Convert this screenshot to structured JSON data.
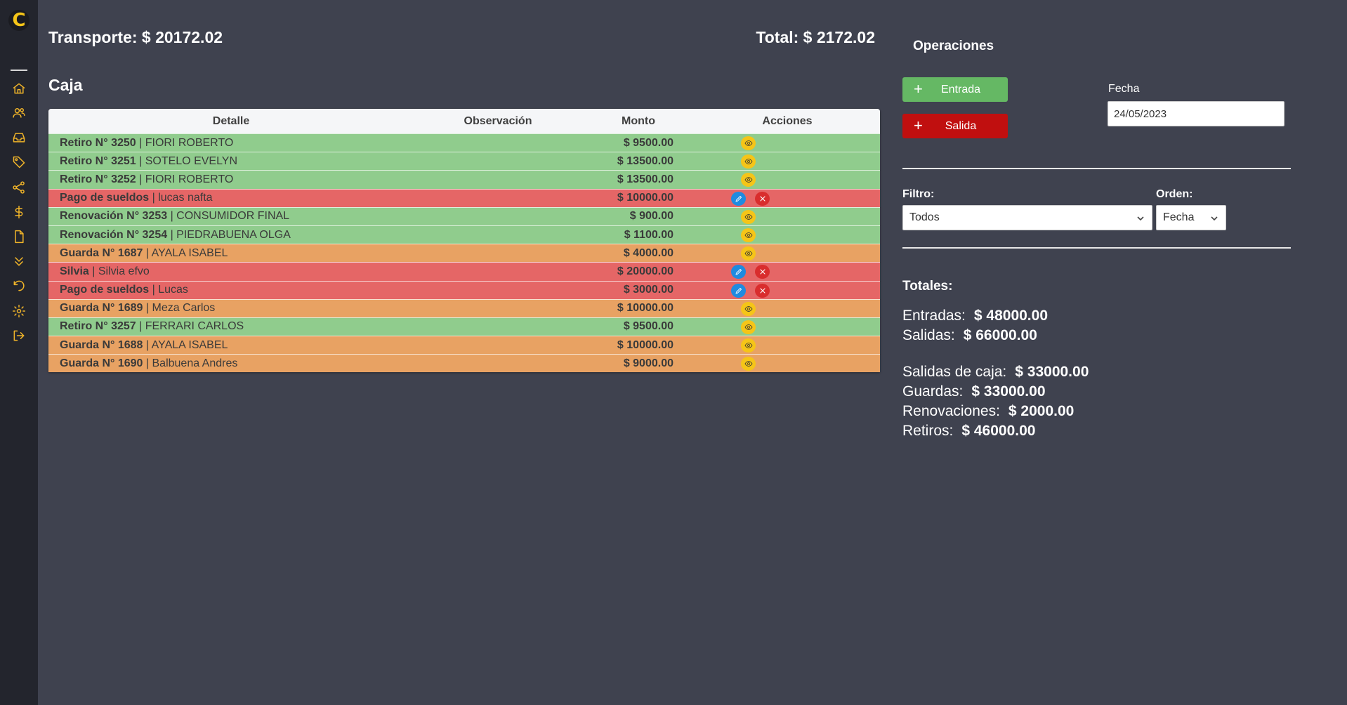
{
  "sidebar": {
    "logo": "C",
    "icons": [
      "home-icon",
      "users-icon",
      "inbox-icon",
      "tag-icon",
      "share-icon",
      "dollar-icon",
      "file-icon",
      "chevrons-down-icon",
      "undo-icon",
      "settings-icon",
      "logout-icon"
    ]
  },
  "header": {
    "transporte": "Transporte: $ 20172.02",
    "total": "Total: $ 2172.02"
  },
  "caja": {
    "title": "Caja",
    "columns": [
      "Detalle",
      "Observación",
      "Monto",
      "Acciones"
    ],
    "rows": [
      {
        "label": "Retiro N° 3250",
        "name": " | FIORI ROBERTO",
        "obs": "",
        "monto": "$ 9500.00",
        "color": "green",
        "actions": "view"
      },
      {
        "label": "Retiro N° 3251",
        "name": " | SOTELO EVELYN",
        "obs": "",
        "monto": "$ 13500.00",
        "color": "green",
        "actions": "view"
      },
      {
        "label": "Retiro N° 3252",
        "name": " | FIORI ROBERTO",
        "obs": "",
        "monto": "$ 13500.00",
        "color": "green",
        "actions": "view"
      },
      {
        "label": "Pago de sueldos",
        "name": " | lucas nafta",
        "obs": "",
        "monto": "$ 10000.00",
        "color": "red",
        "actions": "edit"
      },
      {
        "label": "Renovación N° 3253",
        "name": " | CONSUMIDOR FINAL",
        "obs": "",
        "monto": "$ 900.00",
        "color": "green",
        "actions": "view"
      },
      {
        "label": "Renovación N° 3254",
        "name": " | PIEDRABUENA OLGA",
        "obs": "",
        "monto": "$ 1100.00",
        "color": "green",
        "actions": "view"
      },
      {
        "label": "Guarda N° 1687",
        "name": " | AYALA ISABEL",
        "obs": "",
        "monto": "$ 4000.00",
        "color": "orange",
        "actions": "view"
      },
      {
        "label": "Silvia",
        "name": " | Silvia efvo",
        "obs": "",
        "monto": "$ 20000.00",
        "color": "red",
        "actions": "edit"
      },
      {
        "label": "Pago de sueldos",
        "name": " | Lucas",
        "obs": "",
        "monto": "$ 3000.00",
        "color": "red",
        "actions": "edit"
      },
      {
        "label": "Guarda N° 1689",
        "name": " | Meza Carlos",
        "obs": "",
        "monto": "$ 10000.00",
        "color": "orange",
        "actions": "view"
      },
      {
        "label": "Retiro N° 3257",
        "name": " | FERRARI CARLOS",
        "obs": "",
        "monto": "$ 9500.00",
        "color": "green",
        "actions": "view"
      },
      {
        "label": "Guarda N° 1688",
        "name": " | AYALA ISABEL",
        "obs": "",
        "monto": "$ 10000.00",
        "color": "orange",
        "actions": "view"
      },
      {
        "label": "Guarda N° 1690",
        "name": " | Balbuena Andres",
        "obs": "",
        "monto": "$ 9000.00",
        "color": "orange",
        "actions": "view"
      }
    ]
  },
  "operaciones": {
    "title": "Operaciones",
    "entrada_label": "Entrada",
    "salida_label": "Salida",
    "fecha_label": "Fecha",
    "fecha_value": "24/05/2023",
    "filtro_label": "Filtro:",
    "filtro_value": "Todos",
    "orden_label": "Orden:",
    "orden_value": "Fecha"
  },
  "totales": {
    "title": "Totales:",
    "entradas_label": "Entradas:",
    "entradas_value": "$ 48000.00",
    "salidas_label": "Salidas:",
    "salidas_value": "$ 66000.00",
    "salidas_caja_label": "Salidas de caja:",
    "salidas_caja_value": "$ 33000.00",
    "guardas_label": "Guardas:",
    "guardas_value": "$ 33000.00",
    "renovaciones_label": "Renovaciones:",
    "renovaciones_value": "$ 2000.00",
    "retiros_label": "Retiros:",
    "retiros_value": "$ 46000.00"
  },
  "colors": {
    "green_row": "#90cc8d",
    "red_row": "#e56666",
    "orange_row": "#e8a263",
    "accent_yellow": "#f5c518",
    "entrada_btn": "#65b864",
    "salida_btn": "#c00f0f"
  }
}
